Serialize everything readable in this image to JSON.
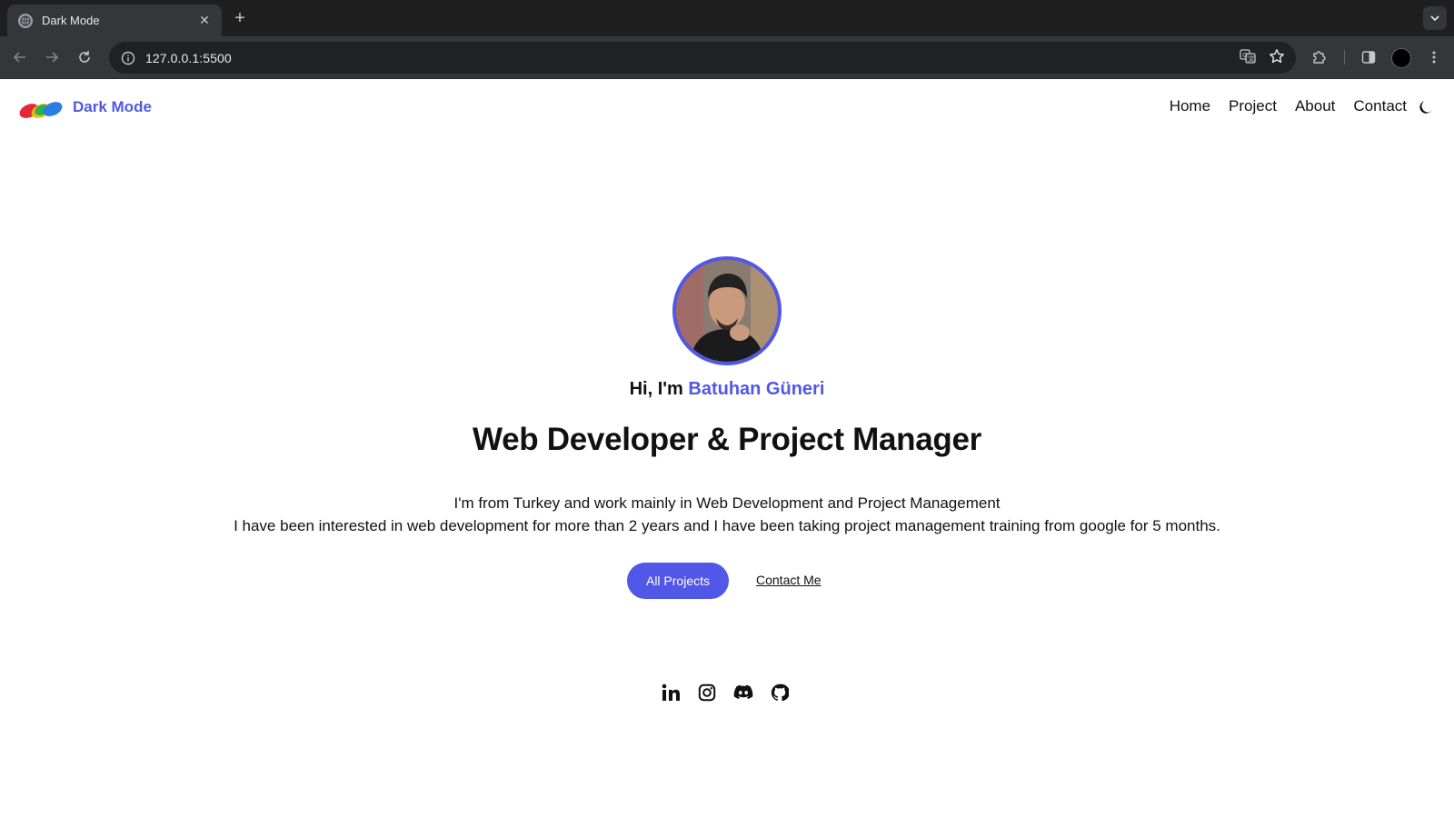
{
  "browser": {
    "tab_title": "Dark Mode",
    "url": "127.0.0.1:5500",
    "new_tab_symbol": "+",
    "close_symbol": "✕"
  },
  "header": {
    "brand": "Dark Mode",
    "nav": [
      "Home",
      "Project",
      "About",
      "Contact"
    ],
    "theme_icon": "moon-icon"
  },
  "hero": {
    "greeting": "Hi, I'm",
    "name": "Batuhan Güneri",
    "headline": "Web Developer & Project Manager",
    "intro_line1": "I'm from Turkey and work mainly in Web Development and Project Management",
    "intro_line2": "I have been interested in web development for more than 2 years and I have been taking project management training from google for 5 months.",
    "primary_button": "All Projects",
    "secondary_link": "Contact Me"
  },
  "socials": [
    "linkedin-icon",
    "instagram-icon",
    "discord-icon",
    "github-icon"
  ],
  "colors": {
    "accent": "#5157e6",
    "text": "#111111",
    "chrome_dark": "#1f1f1f",
    "chrome_toolbar": "#35363a"
  }
}
